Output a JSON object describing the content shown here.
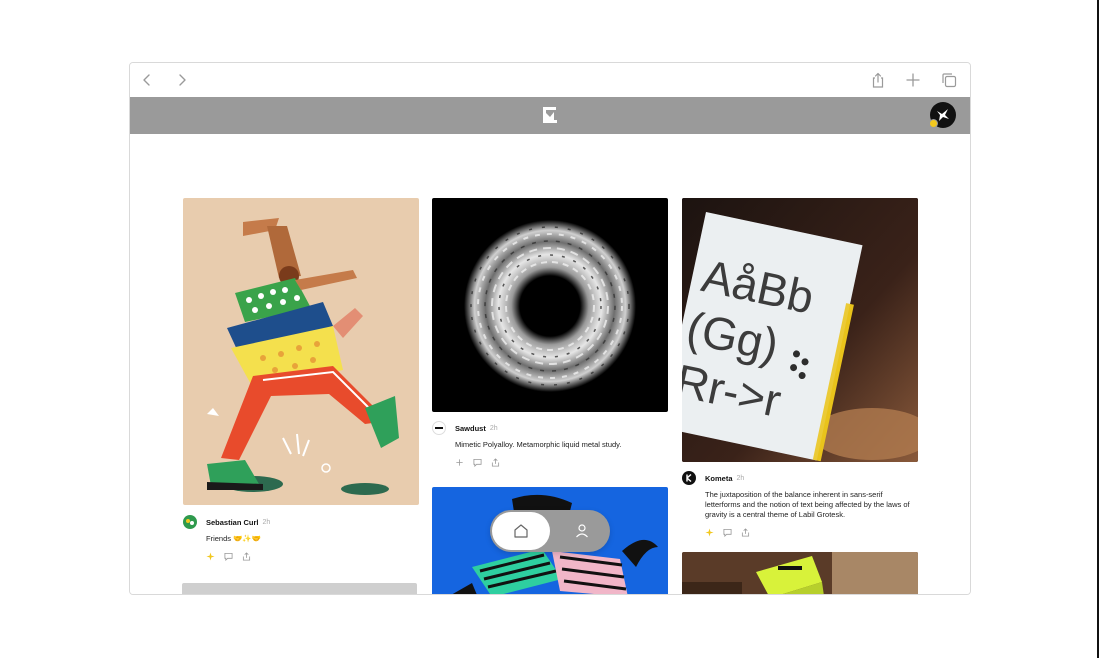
{
  "colors": {
    "appbar": "#9a9a9a",
    "accent_yellow": "#f2c81f",
    "blue_card": "#1565e0",
    "peach": "#e8ccae"
  },
  "browser": {
    "back_icon": "chevron-left-icon",
    "forward_icon": "chevron-right-icon",
    "share_icon": "share-icon",
    "new_tab_icon": "plus-icon",
    "tabs_icon": "tabs-icon"
  },
  "app": {
    "logo_icon": "app-logo-icon",
    "avatar_icon": "user-avatar-icon"
  },
  "posts": [
    {
      "author": "Sebastian Curl",
      "time": "2h",
      "caption": "Friends 🤝✨🤝",
      "image": "illustration-dancing-friends"
    },
    {
      "author": "Sawdust",
      "time": "2h",
      "caption": "Mimetic Polyalloy. Metamorphic liquid metal study.",
      "image": "liquid-metal-ring"
    },
    {
      "author": "Kometa",
      "time": "2h",
      "caption": "The juxtaposition of the balance inherent in sans-serif letterforms and the notion of text being affected by the laws of gravity is a central theme of Labil Grotesk.",
      "image": "type-specimen-poster",
      "poster_text": [
        "AåBb",
        "(Gg)",
        "Rr->r"
      ]
    },
    {
      "image": "blue-illustration"
    },
    {
      "image": "yellow-object-photo"
    }
  ],
  "bottom_nav": {
    "home_icon": "home-icon",
    "profile_icon": "profile-icon"
  }
}
